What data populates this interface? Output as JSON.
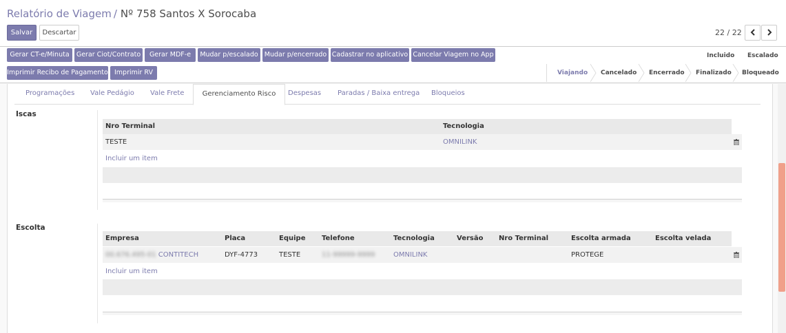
{
  "breadcrumb": {
    "parent": "Relatório de Viagem",
    "separator": "/",
    "current": "Nº 758 Santos X Sorocaba"
  },
  "actions": {
    "save": "Salvar",
    "discard": "Descartar"
  },
  "pager": {
    "value": "22 / 22",
    "prev_icon": "chevron-left-icon",
    "next_icon": "chevron-right-icon"
  },
  "header_buttons": [
    "Gerar CT-e/Minuta",
    "Gerar Ciot/Contrato",
    "Gerar MDF-e",
    "Mudar p/escalado",
    "Mudar p/encerrado",
    "Cadastrar no aplicativo",
    "Cancelar Viagem no App",
    "Imprimir Recibo de Pagamento",
    "Imprimir RV"
  ],
  "status_top": [
    "Incluido",
    "Escalado"
  ],
  "status_bottom": [
    "Viajando",
    "Cancelado",
    "Encerrado",
    "Finalizado",
    "Bloqueado"
  ],
  "status_active": "Viajando",
  "tabs": [
    "Programações",
    "Vale Pedágio",
    "Vale Frete",
    "Gerenciamento Risco",
    "Despesas",
    "Paradas / Baixa entrega",
    "Bloqueios"
  ],
  "active_tab": "Gerenciamento Risco",
  "iscas": {
    "label": "Iscas",
    "columns": [
      "Nro Terminal",
      "Tecnologia"
    ],
    "rows": [
      {
        "nro_terminal": "TESTE",
        "tecnologia": "OMNILINK"
      }
    ],
    "add_item": "Incluir um item"
  },
  "escolta": {
    "label": "Escolta",
    "columns": [
      "Empresa",
      "Placa",
      "Equipe",
      "Telefone",
      "Tecnologia",
      "Versão",
      "Nro Terminal",
      "Escolta armada",
      "Escolta velada"
    ],
    "rows": [
      {
        "empresa_prefix": "00.676.495-01",
        "empresa": "CONTITECH",
        "placa": "DYF-4773",
        "equipe": "TESTE",
        "telefone": "11-99999-9999",
        "tecnologia": "OMNILINK",
        "versao": "",
        "nro_terminal": "",
        "escolta_armada": "PROTEGE",
        "escolta_velada": ""
      }
    ],
    "add_item": "Incluir um item"
  },
  "colors": {
    "primary": "#7c7bad",
    "scroll_thumb": "#f0a08a"
  },
  "icons": {
    "delete": "trash-icon"
  }
}
